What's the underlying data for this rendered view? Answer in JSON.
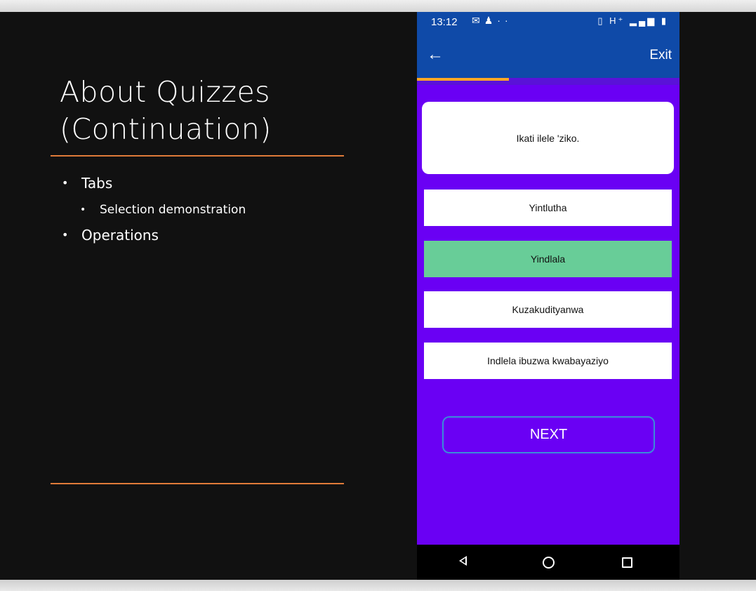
{
  "slide": {
    "title_line1": "About Quizzes",
    "title_line2": "(Continuation)",
    "bullets": {
      "tabs": "Tabs",
      "selection_demo": "Selection demonstration",
      "operations": "Operations"
    }
  },
  "phone": {
    "status_bar": {
      "time": "13:12",
      "network": "H⁺"
    },
    "app_bar": {
      "back_icon": "arrow-left-icon",
      "exit_label": "Exit"
    },
    "progress": 0.35,
    "question": "Ikati ilele 'ziko.",
    "options": [
      {
        "label": "Yintlutha",
        "selected": false
      },
      {
        "label": "Yindlala",
        "selected": true
      },
      {
        "label": "Kuzakudityanwa",
        "selected": false
      },
      {
        "label": "Indlela ibuzwa kwabayaziyo",
        "selected": false
      }
    ],
    "next_label": "NEXT",
    "nav_bar": [
      "back-triangle-icon",
      "home-circle-icon",
      "recents-square-icon"
    ]
  },
  "colors": {
    "slide_bg": "#111111",
    "accent_rule": "#e07b39",
    "app_bar": "#0f4aa8",
    "quiz_bg": "#6a00f4",
    "progress_fill": "#ffa726",
    "selected_option": "#68cd98",
    "next_border": "#3b8cd8"
  }
}
